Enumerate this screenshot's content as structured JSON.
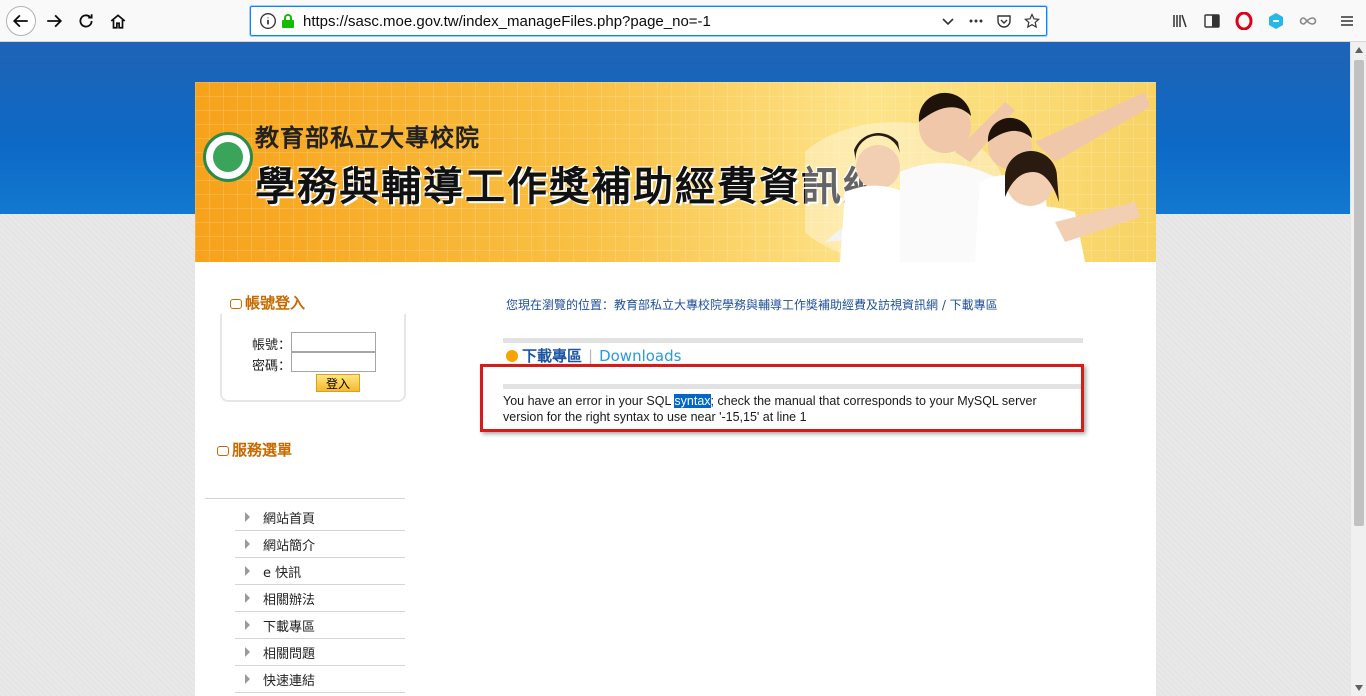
{
  "browser": {
    "url": "https://sasc.moe.gov.tw/index_manageFiles.php?page_no=-1"
  },
  "banner": {
    "line1": "教育部私立大專校院",
    "line2": "學務與輔導工作獎補助經費資訊網"
  },
  "login": {
    "title": "帳號登入",
    "account_label": "帳號：",
    "password_label": "密碼：",
    "account_value": "",
    "password_value": "",
    "submit_label": "登入"
  },
  "menu": {
    "title": "服務選單",
    "items": [
      {
        "label": "網站首頁"
      },
      {
        "label": "網站簡介"
      },
      {
        "label": "e 快訊"
      },
      {
        "label": "相關辦法"
      },
      {
        "label": "下載專區"
      },
      {
        "label": "相關問題"
      },
      {
        "label": "快速連結"
      }
    ]
  },
  "content": {
    "breadcrumb": "您現在瀏覽的位置：教育部私立大專校院學務與輔導工作獎補助經費及訪視資訊網 / 下載專區",
    "section_title_zh": "下載專區",
    "section_separator": "|",
    "section_title_en": "Downloads",
    "error_before": "You have an error in your SQL ",
    "error_highlight": "syntax",
    "error_after": "; check the manual that corresponds to your MySQL server version for the right syntax to use near '-15,15' at line 1"
  },
  "colors": {
    "accent": "#0a84ff",
    "highlight_box": "#d71a1a",
    "menu_title": "#c86a00",
    "link_blue": "#1d56a3"
  }
}
